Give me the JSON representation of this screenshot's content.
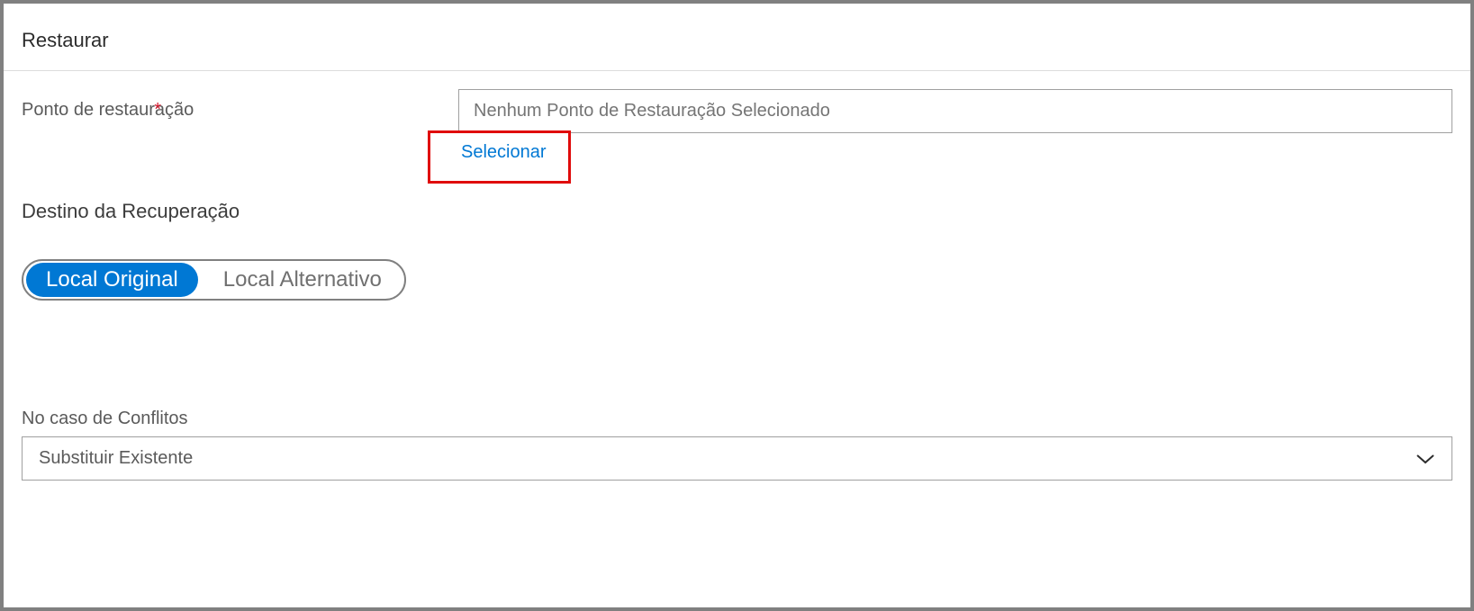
{
  "header": {
    "title": "Restaurar"
  },
  "restorePoint": {
    "label": "Ponto de restauração",
    "required_marker": "*",
    "placeholder": "Nenhum Ponto de Restauração Selecionado",
    "select_link": "Selecionar"
  },
  "recoveryDestination": {
    "heading": "Destino da Recuperação",
    "options": {
      "original": "Local Original",
      "alternative": "Local Alternativo"
    }
  },
  "conflicts": {
    "label": "No caso de Conflitos",
    "selected": "Substituir Existente"
  }
}
